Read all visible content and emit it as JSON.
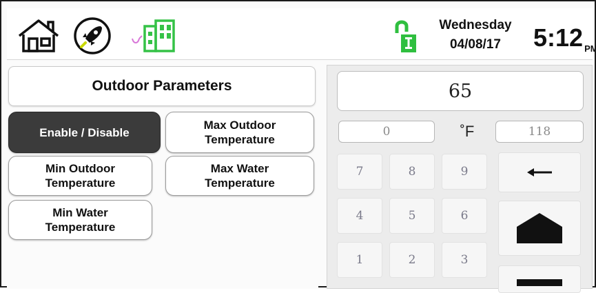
{
  "header": {
    "day": "Wednesday",
    "date": "04/08/17",
    "time": "5:12",
    "ampm": "PM",
    "icons": [
      "home-icon",
      "rocket-icon",
      "building-icon",
      "lock-icon"
    ],
    "colors": {
      "rocket": "#c9d800",
      "building": "#35c247",
      "lock": "#2fbf3f",
      "link": "#d877d8"
    }
  },
  "panel": {
    "title": "Outdoor Parameters",
    "buttons": {
      "enable": "Enable / Disable",
      "max_outdoor": [
        "Max Outdoor",
        "Temperature"
      ],
      "min_outdoor": [
        "Min Outdoor",
        "Temperature"
      ],
      "max_water": [
        "Max Water",
        "Temperature"
      ],
      "min_water": [
        "Min Water",
        "Temperature"
      ]
    },
    "active_button": "Enable / Disable",
    "active_color": "#3b3b3b"
  },
  "keypad": {
    "value": "65",
    "min": "0",
    "max": "118",
    "unit": "˚F",
    "keys": [
      "7",
      "8",
      "9",
      "4",
      "5",
      "6",
      "1",
      "2",
      "3"
    ],
    "icons": [
      "backspace-icon",
      "arrow-up-icon",
      "arrow-down-icon"
    ]
  }
}
